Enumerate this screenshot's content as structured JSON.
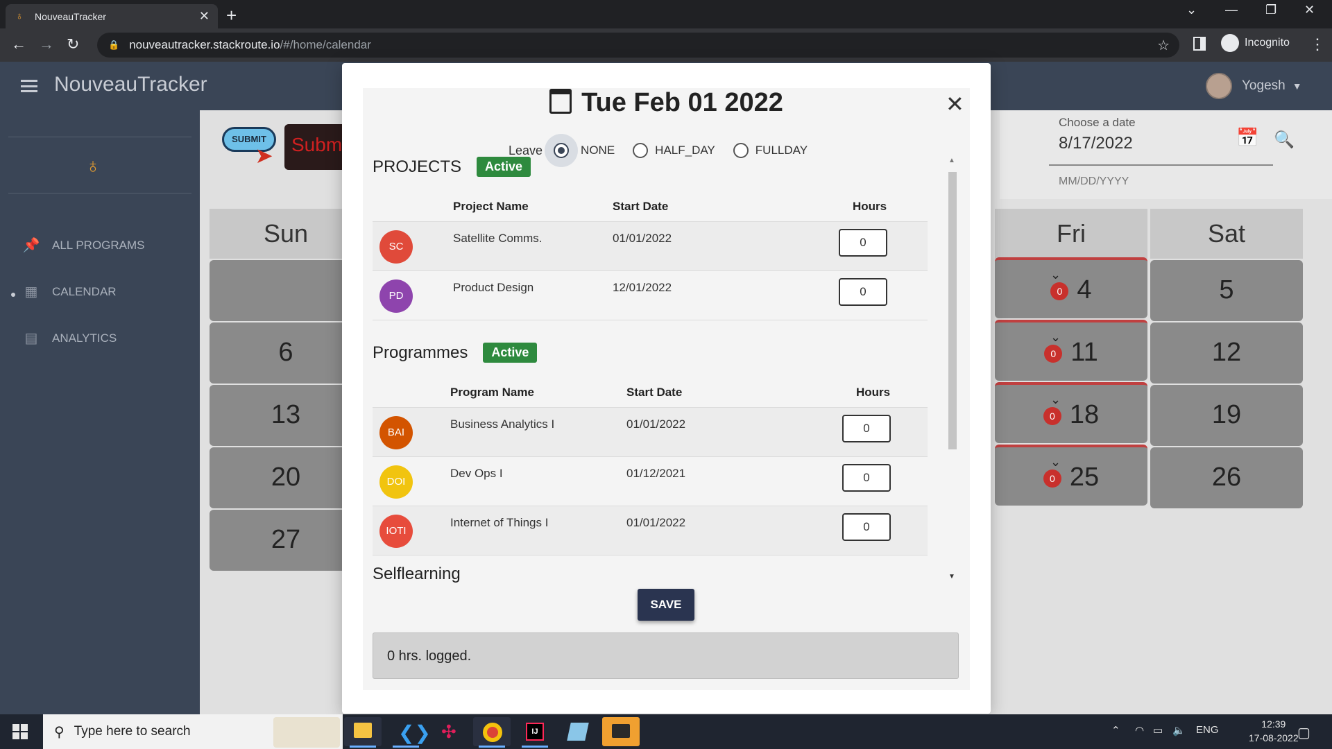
{
  "browser": {
    "tab_title": "NouveauTracker",
    "url_domain": "nouveautracker.stackroute.io",
    "url_path": "/#/home/calendar",
    "profile_label": "Incognito"
  },
  "app": {
    "brand": "NouveauTracker",
    "user_name": "Yogesh",
    "nav": [
      {
        "label": "ALL PROGRAMS",
        "icon": "pin-icon"
      },
      {
        "label": "CALENDAR",
        "icon": "calendar-icon"
      },
      {
        "label": "ANALYTICS",
        "icon": "document-icon"
      }
    ],
    "submit_logo_text": "SUBMIT",
    "submit_button_text": "Subm",
    "date_picker": {
      "label": "Choose a date",
      "value": "8/17/2022",
      "hint": "MM/DD/YYYY"
    }
  },
  "calendar": {
    "headers": [
      "Sun",
      "Fri",
      "Sat"
    ],
    "sun": [
      "",
      "6",
      "13",
      "20",
      "27"
    ],
    "fri": [
      {
        "day": "4",
        "badge": "0"
      },
      {
        "day": "11",
        "badge": "0"
      },
      {
        "day": "18",
        "badge": "0"
      },
      {
        "day": "25",
        "badge": "0"
      }
    ],
    "sat": [
      "5",
      "12",
      "19",
      "26"
    ]
  },
  "modal": {
    "title": "Tue Feb 01 2022",
    "leave_label": "Leave",
    "leave_options": [
      "NONE",
      "HALF_DAY",
      "FULLDAY"
    ],
    "leave_selected": "NONE",
    "projects": {
      "title": "PROJECTS",
      "status": "Active",
      "headers": [
        "Project Name",
        "Start Date",
        "Hours"
      ],
      "rows": [
        {
          "initials": "SC",
          "name": "Satellite Comms.",
          "start": "01/01/2022",
          "hours": "0",
          "color": "#e04a3a"
        },
        {
          "initials": "PD",
          "name": "Product Design",
          "start": "12/01/2022",
          "hours": "0",
          "color": "#8e44ad"
        }
      ]
    },
    "programmes": {
      "title": "Programmes",
      "status": "Active",
      "headers": [
        "Program Name",
        "Start Date",
        "Hours"
      ],
      "rows": [
        {
          "initials": "BAI",
          "name": "Business Analytics I",
          "start": "01/01/2022",
          "hours": "0",
          "color": "#d35400"
        },
        {
          "initials": "DOI",
          "name": "Dev Ops I",
          "start": "01/12/2021",
          "hours": "0",
          "color": "#f1c40f"
        },
        {
          "initials": "IOTI",
          "name": "Internet of Things I",
          "start": "01/01/2022",
          "hours": "0",
          "color": "#e74c3c"
        }
      ]
    },
    "partial_section": "Selflearning",
    "save_label": "SAVE",
    "logged_text": "0 hrs. logged."
  },
  "taskbar": {
    "search_placeholder": "Type here to search",
    "lang": "ENG",
    "time": "12:39",
    "date": "17-08-2022"
  }
}
